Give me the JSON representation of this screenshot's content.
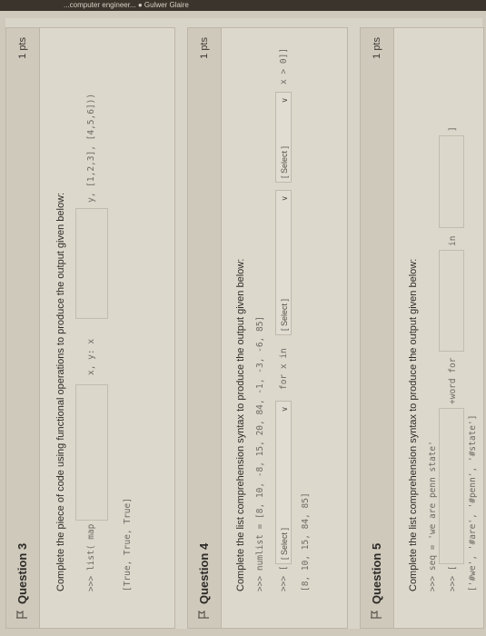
{
  "browser": {
    "tab_text": "...computer engineer... ● Gulwer Glaire"
  },
  "q3": {
    "title": "Question 3",
    "points": "1 pts",
    "prompt": "Complete the piece of code using functional operations to produce the output given below:",
    "line1_prefix": ">>> list( map",
    "line1_mid": "x, y: x",
    "line1_suffix": "y, [1,2,3], [4,5,6]))",
    "output": "[True, True, True]"
  },
  "q4": {
    "title": "Question 4",
    "points": "1 pts",
    "prompt": "Complete the list comprehension syntax to produce the output given below:",
    "line1": ">>> numlist = [8, 10, -8, 15, 20, 84, -1, -3, -6, 85]",
    "line2_prefix": ">>> [",
    "select1": "[ Select ]",
    "line2_mid": "for x in",
    "select2": "[ Select ]",
    "select3": "[ Select ]",
    "line2_suffix": "x > 0]]",
    "output": "[8, 10, 15, 84, 85]"
  },
  "q5": {
    "title": "Question 5",
    "points": "1 pts",
    "prompt": "Complete the list comprehension syntax to produce the output given below:",
    "line1": ">>> seq = 'we are penn state'",
    "line2_prefix": ">>> [",
    "line2_mid": "+word for",
    "line2_in": "in",
    "line2_end": "]",
    "output": "['#we', '#are', '#penn', '#state']"
  }
}
